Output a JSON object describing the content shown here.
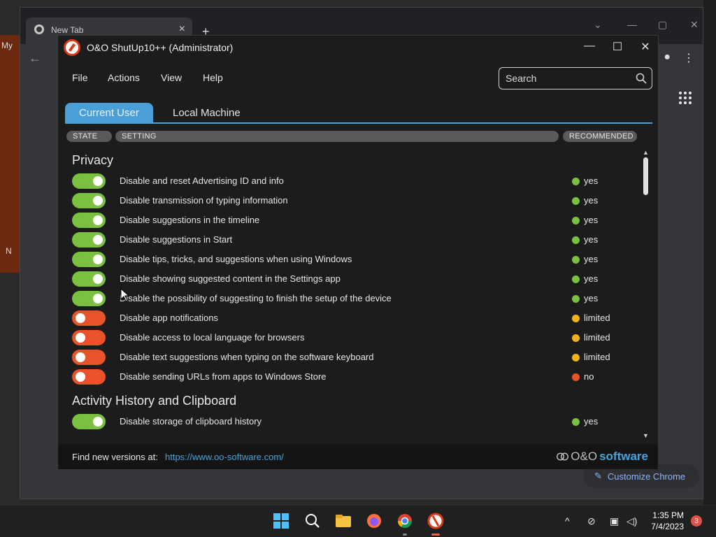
{
  "desktop": {
    "left_labels": [
      "My",
      "N"
    ]
  },
  "chrome": {
    "tab_title": "New Tab",
    "customize_label": "Customize Chrome"
  },
  "app": {
    "title": "O&O ShutUp10++ (Administrator)",
    "menu": [
      "File",
      "Actions",
      "View",
      "Help"
    ],
    "search_placeholder": "Search",
    "tabs": [
      "Current User",
      "Local Machine"
    ],
    "headers": {
      "state": "STATE",
      "setting": "SETTING",
      "recommended": "RECOMMENDED"
    },
    "sections": [
      {
        "title": "Privacy",
        "items": [
          {
            "state": "on",
            "text": "Disable and reset Advertising ID and info",
            "rec": "yes"
          },
          {
            "state": "on",
            "text": "Disable transmission of typing information",
            "rec": "yes"
          },
          {
            "state": "on",
            "text": "Disable suggestions in the timeline",
            "rec": "yes"
          },
          {
            "state": "on",
            "text": "Disable suggestions in Start",
            "rec": "yes"
          },
          {
            "state": "on",
            "text": "Disable tips, tricks, and suggestions when using Windows",
            "rec": "yes"
          },
          {
            "state": "on",
            "text": "Disable showing suggested content in the Settings app",
            "rec": "yes"
          },
          {
            "state": "on",
            "text": "Disable the possibility of suggesting to finish the setup of the device",
            "rec": "yes"
          },
          {
            "state": "off",
            "text": "Disable app notifications",
            "rec": "limited"
          },
          {
            "state": "off",
            "text": "Disable access to local language for browsers",
            "rec": "limited"
          },
          {
            "state": "off",
            "text": "Disable text suggestions when typing on the software keyboard",
            "rec": "limited"
          },
          {
            "state": "off",
            "text": "Disable sending URLs from apps to Windows Store",
            "rec": "no"
          }
        ]
      },
      {
        "title": "Activity History and Clipboard",
        "items": [
          {
            "state": "on",
            "text": "Disable storage of clipboard history",
            "rec": "yes"
          }
        ]
      }
    ],
    "footer": {
      "text": "Find new versions at:",
      "link": "https://www.oo-software.com/",
      "brand_prefix": "O&O",
      "brand_strong": "software"
    }
  },
  "colors": {
    "toggle_on": "#7bc043",
    "toggle_off": "#e8532a",
    "rec_yes": "#7bc043",
    "rec_limited": "#f2b21c",
    "rec_no": "#e8532a",
    "accent": "#4aa3d8"
  },
  "taskbar": {
    "icons": [
      "windows-start-icon",
      "search-icon",
      "file-explorer-icon",
      "firefox-icon",
      "chrome-icon",
      "shutup10-icon"
    ],
    "time": "1:35 PM",
    "date": "7/4/2023",
    "notification_count": "3"
  }
}
